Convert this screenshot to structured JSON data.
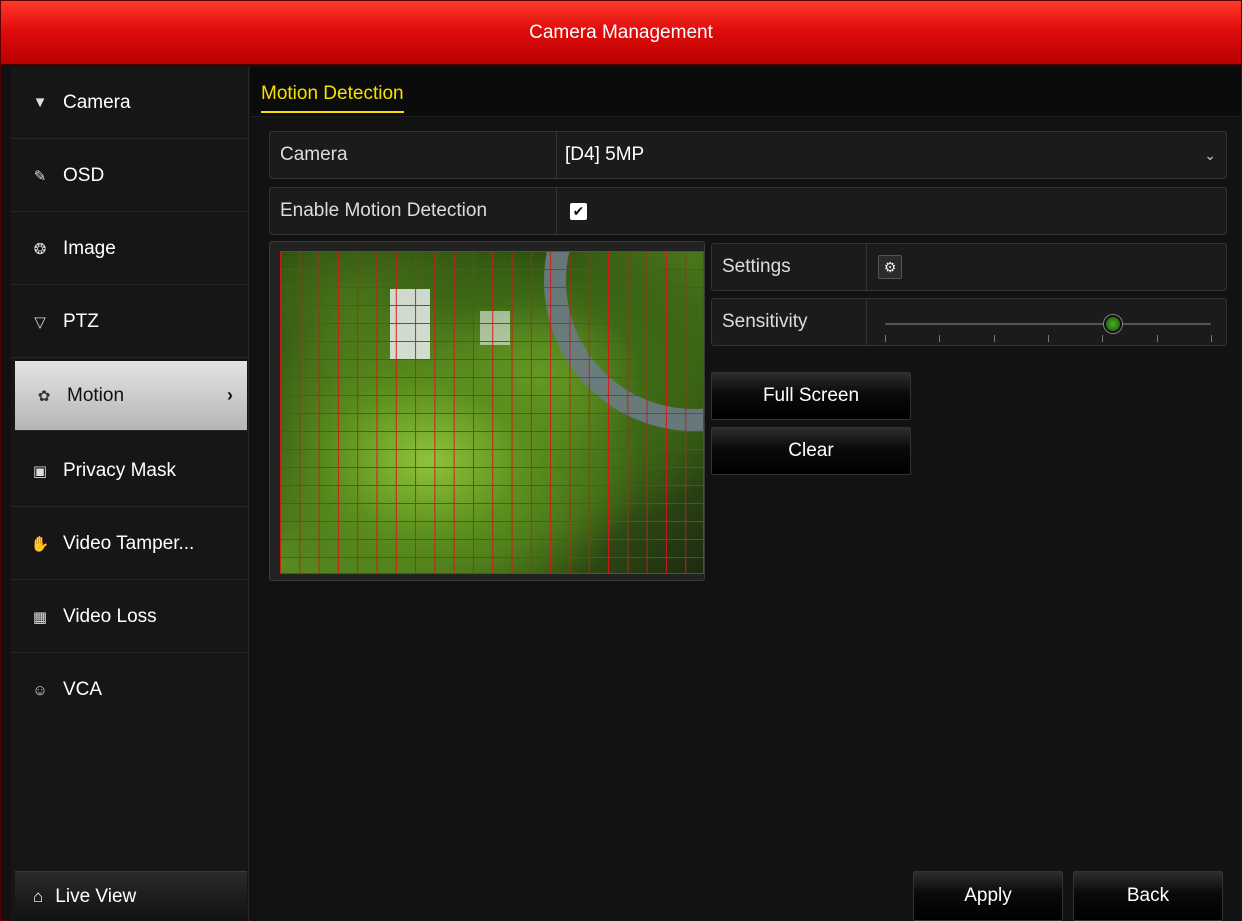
{
  "window": {
    "title": "Camera Management"
  },
  "sidebar": {
    "items": [
      {
        "label": "Camera",
        "icon": "camera-icon"
      },
      {
        "label": "OSD",
        "icon": "osd-icon"
      },
      {
        "label": "Image",
        "icon": "image-icon"
      },
      {
        "label": "PTZ",
        "icon": "ptz-icon"
      },
      {
        "label": "Motion",
        "icon": "motion-icon",
        "active": true
      },
      {
        "label": "Privacy Mask",
        "icon": "privacy-mask-icon"
      },
      {
        "label": "Video Tamper...",
        "icon": "video-tamper-icon"
      },
      {
        "label": "Video Loss",
        "icon": "video-loss-icon"
      },
      {
        "label": "VCA",
        "icon": "vca-icon"
      }
    ],
    "live_view": {
      "label": "Live View",
      "icon": "home-icon"
    }
  },
  "main": {
    "tab": "Motion Detection",
    "camera_row": {
      "label": "Camera",
      "value": "[D4] 5MP"
    },
    "enable_row": {
      "label": "Enable Motion Detection",
      "checked": true
    },
    "settings_row": {
      "label": "Settings"
    },
    "sensitivity_row": {
      "label": "Sensitivity",
      "value_fraction": 0.7
    },
    "buttons": {
      "full_screen": "Full Screen",
      "clear": "Clear"
    },
    "footer": {
      "apply": "Apply",
      "back": "Back"
    }
  },
  "colors": {
    "title_red": "#e10d0d",
    "tab_yellow": "#f5e000",
    "grid_red": "#d81414",
    "slider_green": "#4caf28"
  }
}
